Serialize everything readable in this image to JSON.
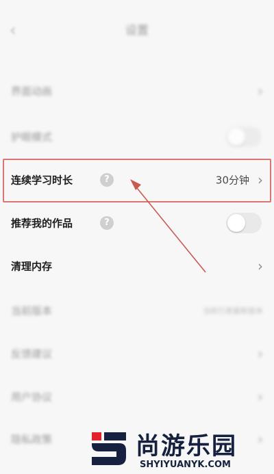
{
  "header": {
    "back_glyph": "‹",
    "title": "设置"
  },
  "rows": [
    {
      "label": "界面动画",
      "chevron": "›"
    },
    {
      "label": "护眼模式"
    },
    {
      "label": "连续学习时长",
      "value": "30分钟",
      "chevron": "›",
      "help": "?"
    },
    {
      "label": "推荐我的作品",
      "help": "?"
    },
    {
      "label": "清理内存",
      "chevron": "›"
    },
    {
      "label": "当前版本",
      "value": "当前已是最新版本"
    },
    {
      "label": "反馈建议",
      "chevron": "›"
    },
    {
      "label": "用户协议",
      "chevron": "›"
    },
    {
      "label": "隐私政策",
      "chevron": "›"
    }
  ],
  "highlight_color": "#d9756e",
  "watermark": {
    "cn": "尚游乐园",
    "en": "SHYIYUANYK.COM"
  }
}
